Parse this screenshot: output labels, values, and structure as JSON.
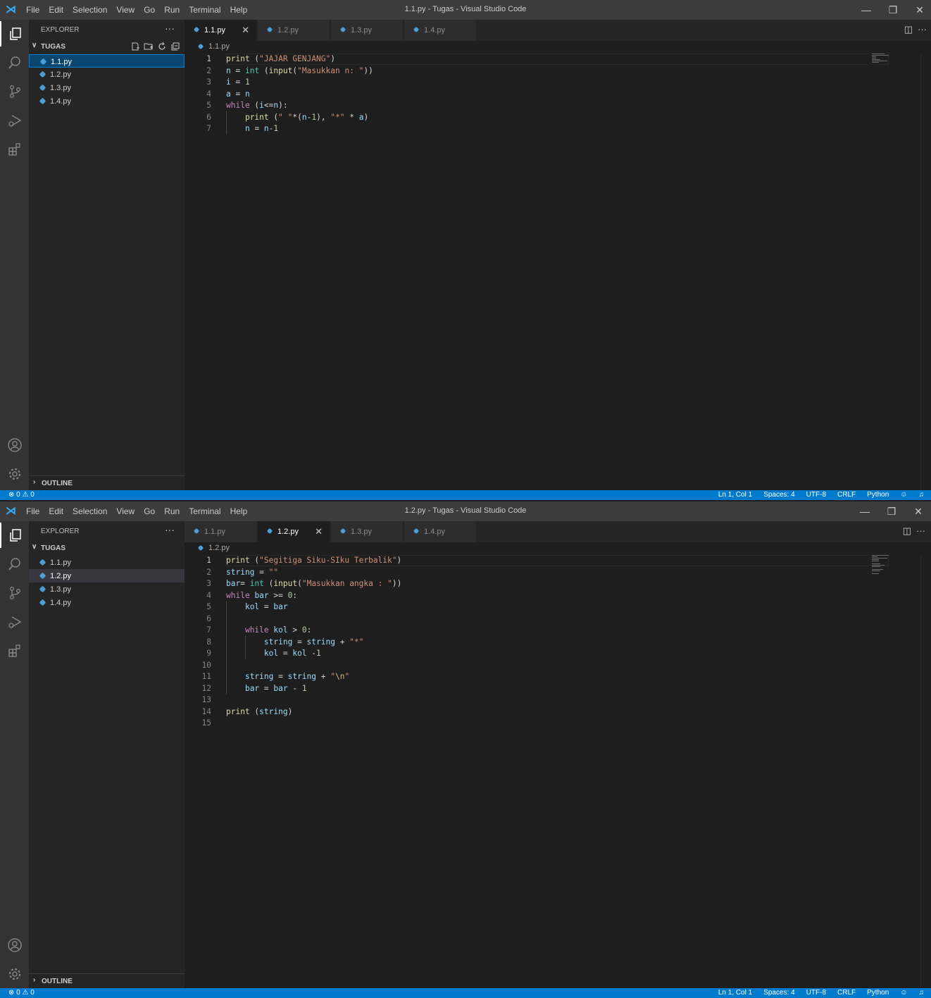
{
  "menu": [
    "File",
    "Edit",
    "Selection",
    "View",
    "Go",
    "Run",
    "Terminal",
    "Help"
  ],
  "sidebar": {
    "header": "EXPLORER",
    "more": "···",
    "folder": "TUGAS",
    "outline": "OUTLINE",
    "files": [
      "1.1.py",
      "1.2.py",
      "1.3.py",
      "1.4.py"
    ]
  },
  "tabs": [
    "1.1.py",
    "1.2.py",
    "1.3.py",
    "1.4.py"
  ],
  "icons": {
    "logo": "vscode-logo-icon",
    "explorer": "files-icon",
    "search": "search-icon",
    "scm": "source-control-icon",
    "debug": "run-debug-icon",
    "extensions": "extensions-icon",
    "account": "account-icon",
    "manage": "gear-icon",
    "close": "close-icon",
    "split": "split-editor-icon",
    "python": "python-file-icon"
  },
  "colors": {
    "titlebar": "#3c3c3c",
    "activitybar": "#333333",
    "sidebar": "#252526",
    "editor": "#1e1e1e",
    "statusbar": "#007acc",
    "keyword": "#c586c0",
    "function": "#dcdcaa",
    "string": "#ce9178",
    "number": "#b5cea8",
    "builtin": "#4ec9b0"
  },
  "status": {
    "problems": "⊗ 0 ⚠ 0",
    "position": "Ln 1, Col 1",
    "spaces": "Spaces: 4",
    "encoding": "UTF-8",
    "eol": "CRLF",
    "language": "Python"
  },
  "windows": [
    {
      "title": "1.1.py - Tugas - Visual Studio Code",
      "active_tab": "1.1.py",
      "breadcrumb": "1.1.py",
      "line_numbers": [
        "1",
        "2",
        "3",
        "4",
        "5",
        "6",
        "7"
      ],
      "lines": [
        "print (\"JAJAR GENJANG\")",
        "n = int (input(\"Masukkan n: \"))",
        "i = 1",
        "a = n",
        "while (i<=n):",
        "    print (\" \"*(n-1), \"*\" * a)",
        "    n = n-1"
      ]
    },
    {
      "title": "1.2.py - Tugas - Visual Studio Code",
      "active_tab": "1.2.py",
      "breadcrumb": "1.2.py",
      "line_numbers": [
        "1",
        "2",
        "3",
        "4",
        "5",
        "6",
        "7",
        "8",
        "9",
        "10",
        "11",
        "12",
        "13",
        "14",
        "15"
      ],
      "lines": [
        "print (\"Segitiga Siku-SIku Terbalik\")",
        "string = \"\"",
        "bar= int (input(\"Masukkan angka : \"))",
        "while bar >= 0:",
        "    kol = bar",
        "",
        "    while kol > 0:",
        "        string = string + \"*\"",
        "        kol = kol -1",
        "",
        "    string = string + \"\\n\"",
        "    bar = bar - 1",
        "",
        "print (string)",
        ""
      ]
    }
  ]
}
